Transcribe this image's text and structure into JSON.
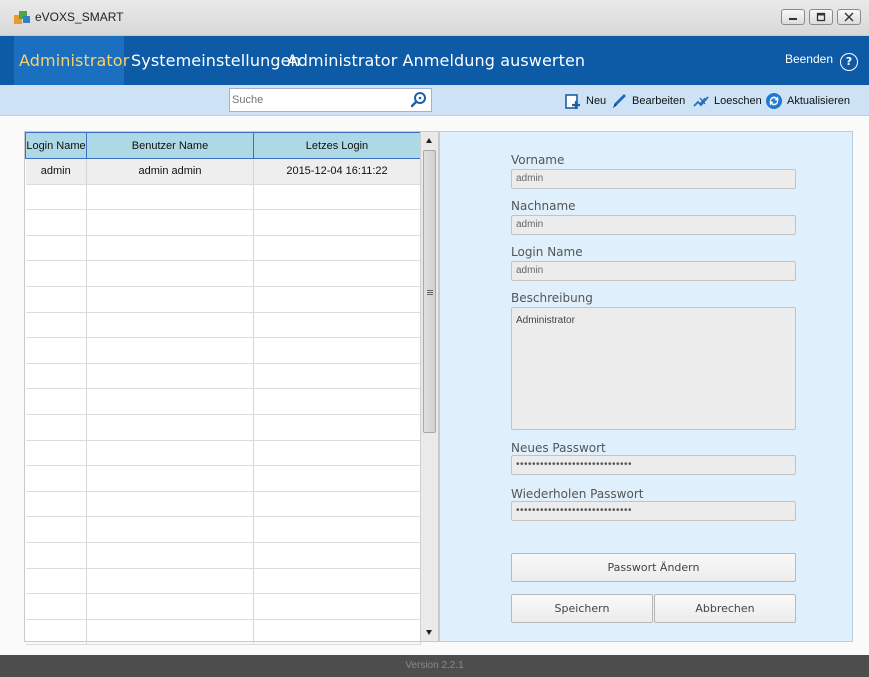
{
  "window": {
    "title": "eVOXS_SMART"
  },
  "menu": {
    "items": [
      {
        "label": "Administrator",
        "active": true
      },
      {
        "label": "Systemeinstellungen"
      },
      {
        "label": "Administrator Anmeldung auswerten"
      }
    ],
    "exit_label": "Beenden",
    "help_symbol": "?"
  },
  "toolbar": {
    "search_placeholder": "Suche",
    "actions": [
      {
        "label": "Neu",
        "icon": "new-icon"
      },
      {
        "label": "Bearbeiten",
        "icon": "pencil-icon"
      },
      {
        "label": "Loeschen",
        "icon": "delete-icon"
      },
      {
        "label": "Aktualisieren",
        "icon": "refresh-icon"
      }
    ]
  },
  "table": {
    "columns": [
      "Login Name",
      "Benutzer Name",
      "Letzes Login"
    ],
    "rows": [
      [
        "admin",
        "admin admin",
        "2015-12-04 16:11:22"
      ]
    ]
  },
  "form": {
    "vorname_label": "Vorname",
    "vorname_value": "admin",
    "nachname_label": "Nachname",
    "nachname_value": "admin",
    "login_label": "Login Name",
    "login_value": "admin",
    "beschreibung_label": "Beschreibung",
    "beschreibung_value": "Administrator",
    "neues_passwort_label": "Neues Passwort",
    "neues_passwort_value": "•••••••••••••••••••••••••••••",
    "wiederholen_label": "Wiederholen Passwort",
    "wiederholen_value": "•••••••••••••••••••••••••••••",
    "change_password_label": "Passwort Ändern",
    "save_label": "Speichern",
    "cancel_label": "Abbrechen"
  },
  "status": {
    "version": "Version 2.2.1"
  },
  "colors": {
    "menu_bg": "#0d5aa6",
    "menu_active_text": "#f7d26a",
    "toolbar_bg": "#cde3f5",
    "form_bg": "#dff0fc",
    "header_bg": "#add8e6"
  }
}
